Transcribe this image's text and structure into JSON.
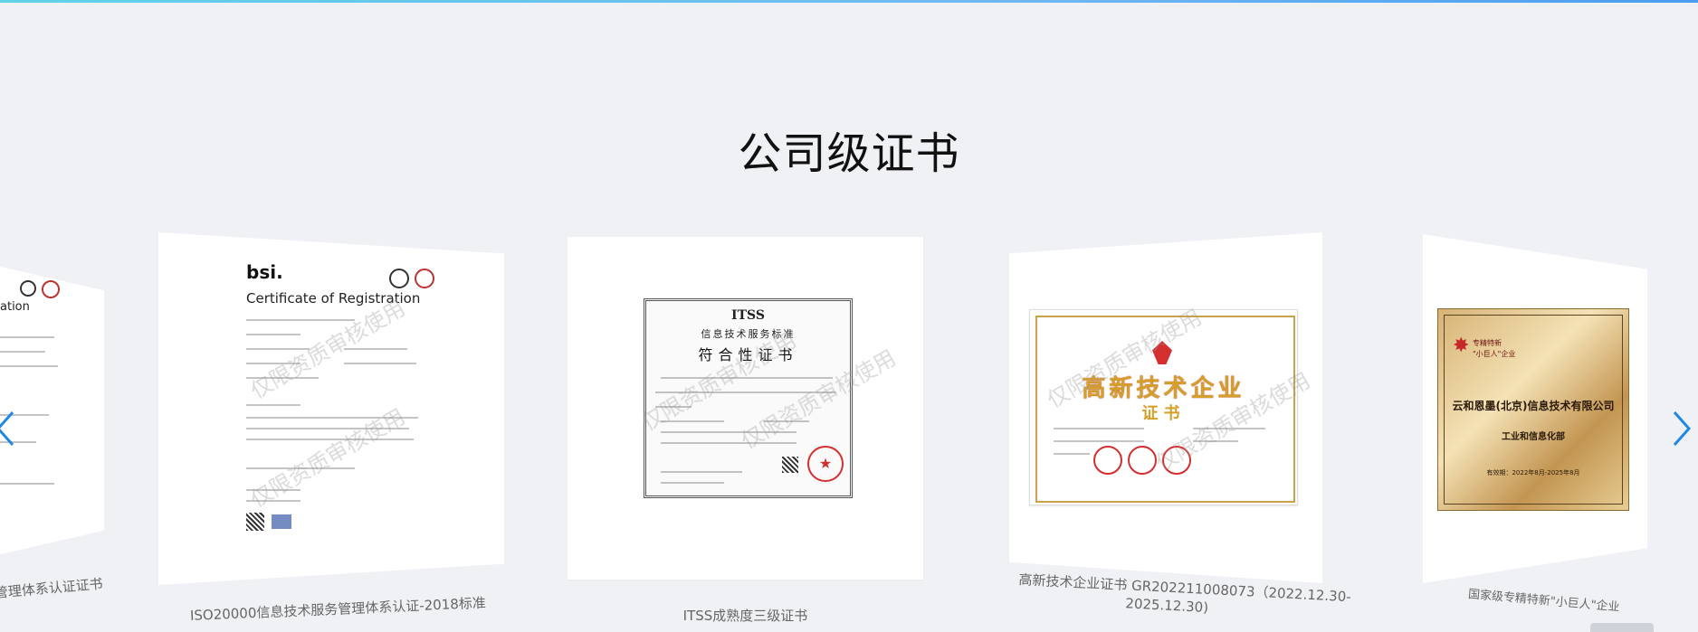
{
  "section": {
    "title": "公司级证书"
  },
  "slides": [
    {
      "caption": "管理体系认证证书",
      "cert_heading": "ation"
    },
    {
      "caption": "ISO20000信息技术服务管理体系认证-2018标准",
      "cert_brand": "bsi.",
      "cert_heading": "Certificate of Registration"
    },
    {
      "caption": "ITSS成熟度三级证书",
      "cert_brand": "ITSS",
      "cert_subtitle": "信息技术服务标准",
      "cert_heading": "符合性证书"
    },
    {
      "caption_line1": "高新技术企业证书 GR202211008073（2022.12.30-",
      "caption_line2": "2025.12.30)",
      "cert_heading": "高新技术企业",
      "cert_sub": "证书"
    },
    {
      "caption": "国家级专精特新\"小巨人\"企业",
      "cert_tag1": "专精特新",
      "cert_tag2": "\"小巨人\"企业",
      "cert_heading": "云和恩墨(北京)信息技术有限公司",
      "cert_sub": "工业和信息化部",
      "cert_date": "有效期：2022年8月-2025年8月"
    }
  ],
  "watermark": "仅限资质审核使用",
  "colors": {
    "accent": "#1e88e5",
    "gold": "#c9a24a",
    "red": "#d32f2f"
  }
}
